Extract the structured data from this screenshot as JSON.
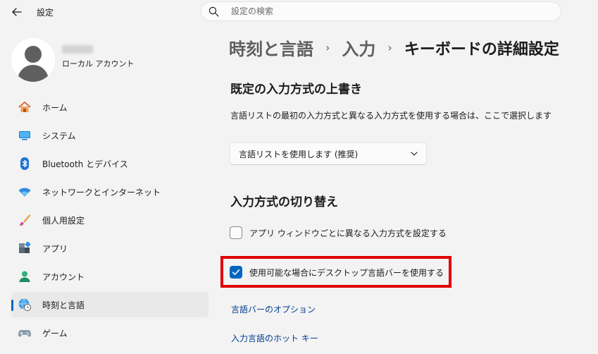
{
  "window": {
    "title": "設定"
  },
  "search": {
    "placeholder": "設定の検索"
  },
  "account": {
    "name": "",
    "type": "ローカル アカウント"
  },
  "sidebar": {
    "items": [
      {
        "label": "ホーム",
        "icon": "home-icon"
      },
      {
        "label": "システム",
        "icon": "system-icon"
      },
      {
        "label": "Bluetooth とデバイス",
        "icon": "bluetooth-icon"
      },
      {
        "label": "ネットワークとインターネット",
        "icon": "network-icon"
      },
      {
        "label": "個人用設定",
        "icon": "brush-icon"
      },
      {
        "label": "アプリ",
        "icon": "apps-icon"
      },
      {
        "label": "アカウント",
        "icon": "account-icon"
      },
      {
        "label": "時刻と言語",
        "icon": "time-language-icon",
        "selected": true
      },
      {
        "label": "ゲーム",
        "icon": "gamepad-icon"
      }
    ]
  },
  "breadcrumb": {
    "level1": "時刻と言語",
    "level2": "入力",
    "current": "キーボードの詳細設定"
  },
  "override": {
    "heading": "既定の入力方式の上書き",
    "description": "言語リストの最初の入力方式と異なる入力方式を使用する場合は、ここで選択します",
    "dropdown_value": "言語リストを使用します (推奨)"
  },
  "switching": {
    "heading": "入力方式の切り替え",
    "per_app_label": "アプリ ウィンドウごとに異なる入力方式を設定する",
    "per_app_checked": false,
    "language_bar_label": "使用可能な場合にデスクトップ言語バーを使用する",
    "language_bar_checked": true
  },
  "links": {
    "language_bar_options": "言語バーのオプション",
    "input_hotkeys": "入力言語のホット キー"
  },
  "colors": {
    "accent": "#0067c0",
    "highlight": "#e00000",
    "link": "#003e92"
  }
}
